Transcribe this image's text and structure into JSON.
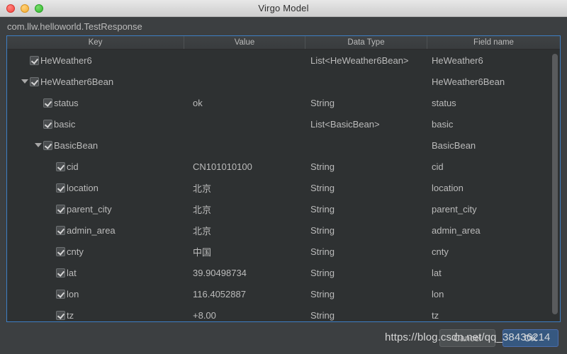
{
  "window": {
    "title": "Virgo Model",
    "traffic_lights": [
      {
        "name": "close-button",
        "color": "#f4433c"
      },
      {
        "name": "minimize-button",
        "color": "#f4ac30"
      },
      {
        "name": "maximize-button",
        "color": "#2fba2b"
      }
    ]
  },
  "classname": "com.llw.helloworld.TestResponse",
  "table": {
    "columns": [
      "Key",
      "Value",
      "Data Type",
      "Field name"
    ],
    "rows": [
      {
        "indent": 0,
        "twisty": "",
        "checked": true,
        "key": "HeWeather6",
        "value": "",
        "type": "List<HeWeather6Bean>",
        "field": "HeWeather6"
      },
      {
        "indent": 0,
        "twisty": "open",
        "checked": true,
        "key": "HeWeather6Bean",
        "value": "",
        "type": "",
        "field": "HeWeather6Bean"
      },
      {
        "indent": 1,
        "twisty": "",
        "checked": true,
        "key": "status",
        "value": "ok",
        "type": "String",
        "field": "status"
      },
      {
        "indent": 1,
        "twisty": "",
        "checked": true,
        "key": "basic",
        "value": "",
        "type": "List<BasicBean>",
        "field": "basic"
      },
      {
        "indent": 1,
        "twisty": "open",
        "checked": true,
        "key": "BasicBean",
        "value": "",
        "type": "",
        "field": "BasicBean"
      },
      {
        "indent": 2,
        "twisty": "",
        "checked": true,
        "key": "cid",
        "value": "CN101010100",
        "type": "String",
        "field": "cid"
      },
      {
        "indent": 2,
        "twisty": "",
        "checked": true,
        "key": "location",
        "value": "北京",
        "type": "String",
        "field": "location"
      },
      {
        "indent": 2,
        "twisty": "",
        "checked": true,
        "key": "parent_city",
        "value": "北京",
        "type": "String",
        "field": "parent_city"
      },
      {
        "indent": 2,
        "twisty": "",
        "checked": true,
        "key": "admin_area",
        "value": "北京",
        "type": "String",
        "field": "admin_area"
      },
      {
        "indent": 2,
        "twisty": "",
        "checked": true,
        "key": "cnty",
        "value": "中国",
        "type": "String",
        "field": "cnty"
      },
      {
        "indent": 2,
        "twisty": "",
        "checked": true,
        "key": "lat",
        "value": "39.90498734",
        "type": "String",
        "field": "lat"
      },
      {
        "indent": 2,
        "twisty": "",
        "checked": true,
        "key": "lon",
        "value": "116.4052887",
        "type": "String",
        "field": "lon"
      },
      {
        "indent": 2,
        "twisty": "",
        "checked": true,
        "key": "tz",
        "value": "+8.00",
        "type": "String",
        "field": "tz"
      }
    ]
  },
  "footer": {
    "cancel_label": "Cancel",
    "ok_label": "OK"
  },
  "watermark": "https://blog.csdn.net/qq_38436214",
  "colors": {
    "panel_background": "#3c3f41",
    "table_background": "#2e3132",
    "focus_border": "#3d7ec4",
    "accent_button": "#365880",
    "text": "#bbbbbb"
  }
}
